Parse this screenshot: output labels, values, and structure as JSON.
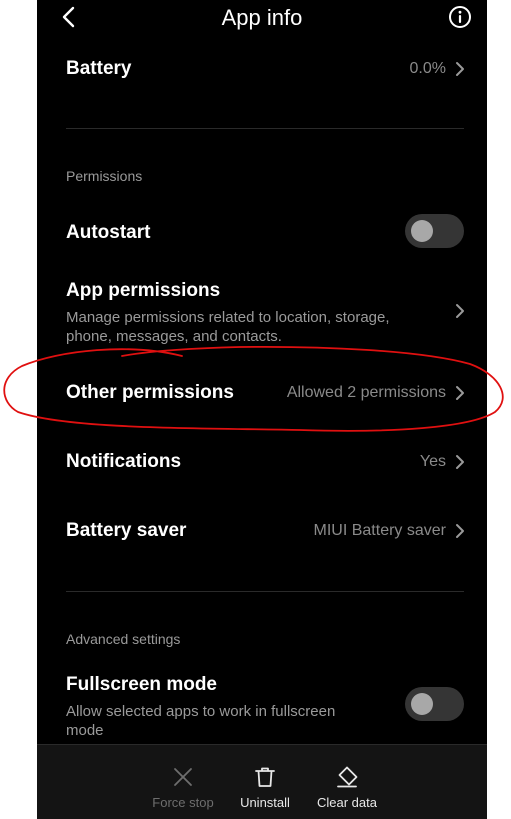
{
  "header": {
    "title": "App info",
    "back_icon": "chevron-left-icon",
    "info_icon": "info-circle-icon"
  },
  "rows": {
    "battery": {
      "title": "Battery",
      "value": "0.0%"
    },
    "permissions_label": "Permissions",
    "autostart": {
      "title": "Autostart",
      "enabled": false
    },
    "app_permissions": {
      "title": "App permissions",
      "description": "Manage permissions related to location, storage, phone, messages, and contacts."
    },
    "other_permissions": {
      "title": "Other permissions",
      "value": "Allowed 2 permissions"
    },
    "notifications": {
      "title": "Notifications",
      "value": "Yes"
    },
    "battery_saver": {
      "title": "Battery saver",
      "value": "MIUI Battery saver"
    },
    "advanced_label": "Advanced settings",
    "fullscreen": {
      "title": "Fullscreen mode",
      "description": "Allow selected apps to work in fullscreen mode",
      "enabled": false
    }
  },
  "bottom_bar": {
    "force_stop": {
      "label": "Force stop",
      "enabled": false
    },
    "uninstall": {
      "label": "Uninstall",
      "enabled": true
    },
    "clear_data": {
      "label": "Clear data",
      "enabled": true
    }
  },
  "colors": {
    "background": "#000000",
    "text_primary": "#ffffff",
    "text_secondary": "#8a8a8a",
    "annotation_stroke": "#e01010"
  }
}
